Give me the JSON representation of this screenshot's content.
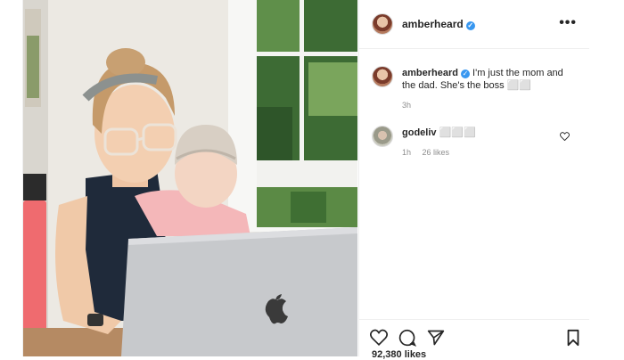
{
  "post": {
    "author": "amberheard",
    "caption": {
      "username": "amberheard",
      "text": "I'm just the mom and the dad. She's the boss ⬜⬜",
      "age": "3h"
    },
    "comments": [
      {
        "username": "godeliv",
        "text": "⬜⬜⬜",
        "age": "1h",
        "likes": "26 likes"
      }
    ],
    "likes_count": "92,380 likes",
    "more_label": "•••"
  },
  "icons": {
    "header_more": "more-options-icon",
    "verified": "verified-badge-icon",
    "like": "heart-icon",
    "comment": "comment-bubble-icon",
    "share": "paper-plane-icon",
    "save": "bookmark-icon"
  },
  "colors": {
    "verified": "#3897f0",
    "text": "#262626",
    "muted": "#8e8e8e",
    "border": "#efefef"
  }
}
